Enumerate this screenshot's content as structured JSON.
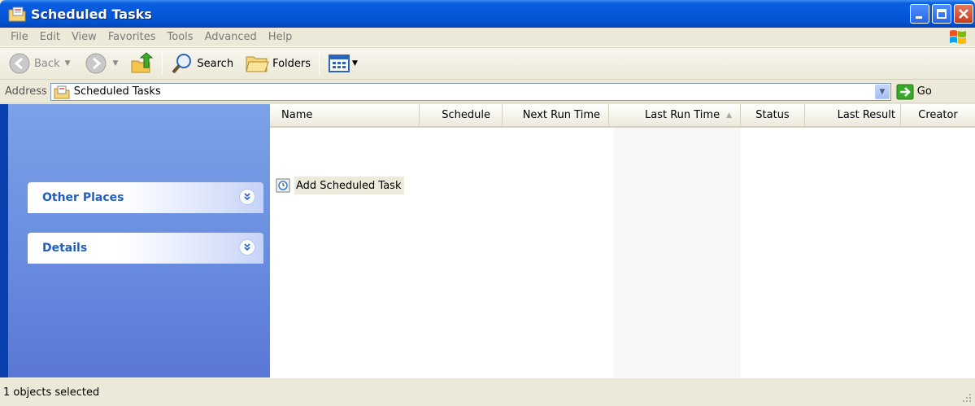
{
  "window": {
    "title": "Scheduled Tasks"
  },
  "menu": [
    "File",
    "Edit",
    "View",
    "Favorites",
    "Tools",
    "Advanced",
    "Help"
  ],
  "toolbar": {
    "back_label": "Back",
    "search_label": "Search",
    "folders_label": "Folders"
  },
  "address": {
    "label": "Address",
    "value": "Scheduled Tasks",
    "go_label": "Go"
  },
  "left_panels": [
    {
      "title": "Other Places"
    },
    {
      "title": "Details"
    }
  ],
  "columns": [
    "Name",
    "Schedule",
    "Next Run Time",
    "Last Run Time",
    "Status",
    "Last Result",
    "Creator"
  ],
  "sorted_column": "Last Run Time",
  "items": [
    {
      "name": "Add Scheduled Task",
      "selected": true
    }
  ],
  "status": {
    "text": "1 objects selected"
  },
  "colors": {
    "titlebar": "#0458d8",
    "panel_bg": "#6a8fe0",
    "panel_title": "#215dc6",
    "chrome": "#ece9d8"
  }
}
